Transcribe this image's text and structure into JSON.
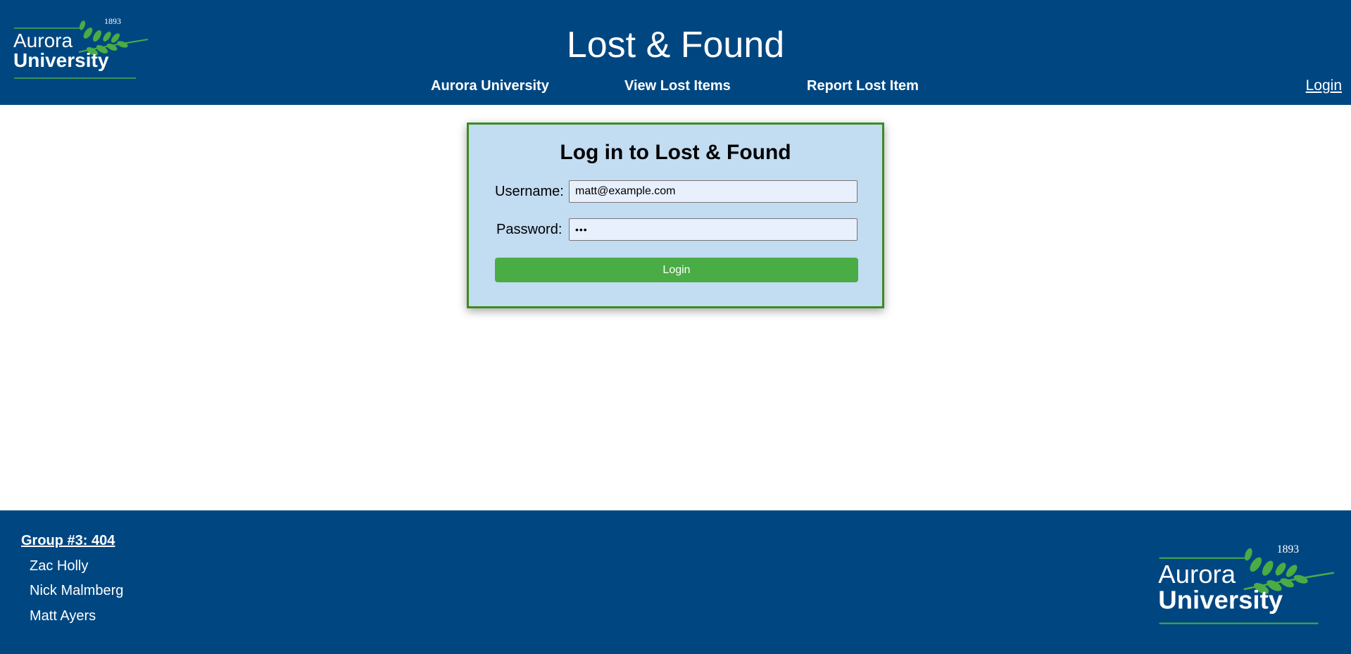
{
  "header": {
    "logo": {
      "year": "1893",
      "line1": "Aurora",
      "line2": "University"
    },
    "title": "Lost & Found",
    "nav": [
      {
        "label": "Aurora University"
      },
      {
        "label": "View Lost Items"
      },
      {
        "label": "Report Lost Item"
      }
    ],
    "login_link": "Login"
  },
  "login_form": {
    "title": "Log in to Lost & Found",
    "username_label": "Username:",
    "username_value": "matt@example.com",
    "password_label": "Password:",
    "password_value": "•••",
    "submit_label": "Login"
  },
  "footer": {
    "group_title": "Group #3: 404",
    "members": [
      "Zac Holly",
      "Nick Malmberg",
      "Matt Ayers"
    ],
    "logo": {
      "year": "1893",
      "line1": "Aurora",
      "line2": "University"
    }
  },
  "colors": {
    "brand_blue": "#004782",
    "accent_green": "#4aac44",
    "card_background": "#c2dcf2",
    "card_border": "#3d8b22"
  }
}
